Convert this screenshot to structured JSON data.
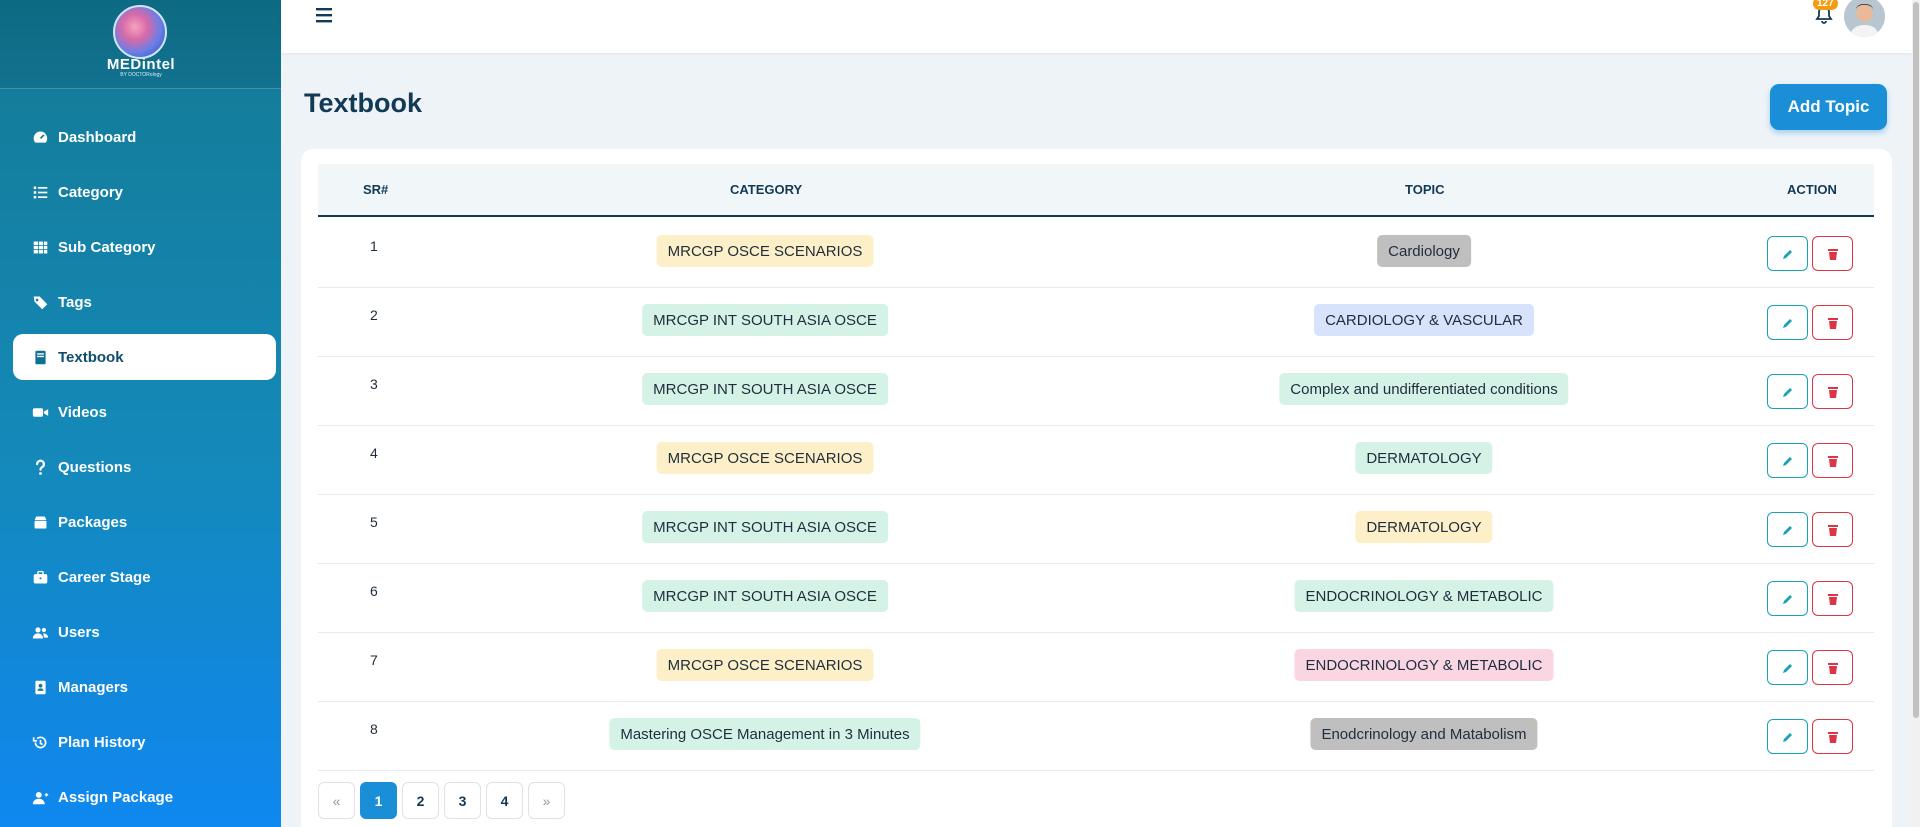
{
  "brand": {
    "name": "MEDintel",
    "tagline": "BY DOCTORology"
  },
  "sidebar": {
    "items": [
      {
        "label": "Dashboard",
        "icon": "dashboard-icon"
      },
      {
        "label": "Category",
        "icon": "list-icon"
      },
      {
        "label": "Sub Category",
        "icon": "grid-icon"
      },
      {
        "label": "Tags",
        "icon": "tags-icon"
      },
      {
        "label": "Textbook",
        "icon": "book-icon",
        "active": true
      },
      {
        "label": "Videos",
        "icon": "video-icon"
      },
      {
        "label": "Questions",
        "icon": "question-icon"
      },
      {
        "label": "Packages",
        "icon": "box-icon"
      },
      {
        "label": "Career Stage",
        "icon": "briefcase-icon"
      },
      {
        "label": "Users",
        "icon": "users-icon"
      },
      {
        "label": "Managers",
        "icon": "id-badge-icon"
      },
      {
        "label": "Plan History",
        "icon": "history-icon"
      },
      {
        "label": "Assign Package",
        "icon": "user-plus-icon"
      }
    ]
  },
  "topbar": {
    "notification_count": "127"
  },
  "page": {
    "title": "Textbook",
    "add_button": "Add Topic"
  },
  "table": {
    "headers": {
      "sr": "SR#",
      "category": "CATEGORY",
      "topic": "TOPIC",
      "action": "ACTION"
    },
    "rows": [
      {
        "sr": "1",
        "category": "MRCGP OSCE SCENARIOS",
        "topic": "Cardiology"
      },
      {
        "sr": "2",
        "category": "MRCGP INT SOUTH ASIA OSCE",
        "topic": "CARDIOLOGY & VASCULAR"
      },
      {
        "sr": "3",
        "category": "MRCGP INT SOUTH ASIA OSCE",
        "topic": "Complex and undifferentiated conditions"
      },
      {
        "sr": "4",
        "category": "MRCGP OSCE SCENARIOS",
        "topic": "DERMATOLOGY"
      },
      {
        "sr": "5",
        "category": "MRCGP INT SOUTH ASIA OSCE",
        "topic": "DERMATOLOGY"
      },
      {
        "sr": "6",
        "category": "MRCGP INT SOUTH ASIA OSCE",
        "topic": "ENDOCRINOLOGY & METABOLIC"
      },
      {
        "sr": "7",
        "category": "MRCGP OSCE SCENARIOS",
        "topic": "ENDOCRINOLOGY & METABOLIC"
      },
      {
        "sr": "8",
        "category": "Mastering OSCE Management in 3 Minutes",
        "topic": "Enodcrinology and Matabolism"
      }
    ]
  },
  "pagination": {
    "prev": "«",
    "pages": [
      "1",
      "2",
      "3",
      "4"
    ],
    "current": "1",
    "next": "»"
  },
  "colors": {
    "pill_yellow": "#fdf0c9",
    "pill_green": "#d4f3e6",
    "pill_gray": "#bfbfbf",
    "pill_blue": "#d6e3fb",
    "pill_pink": "#f9d6e2",
    "accent": "#1a8fd8",
    "edit": "#17a2b8",
    "delete": "#dc3545"
  }
}
